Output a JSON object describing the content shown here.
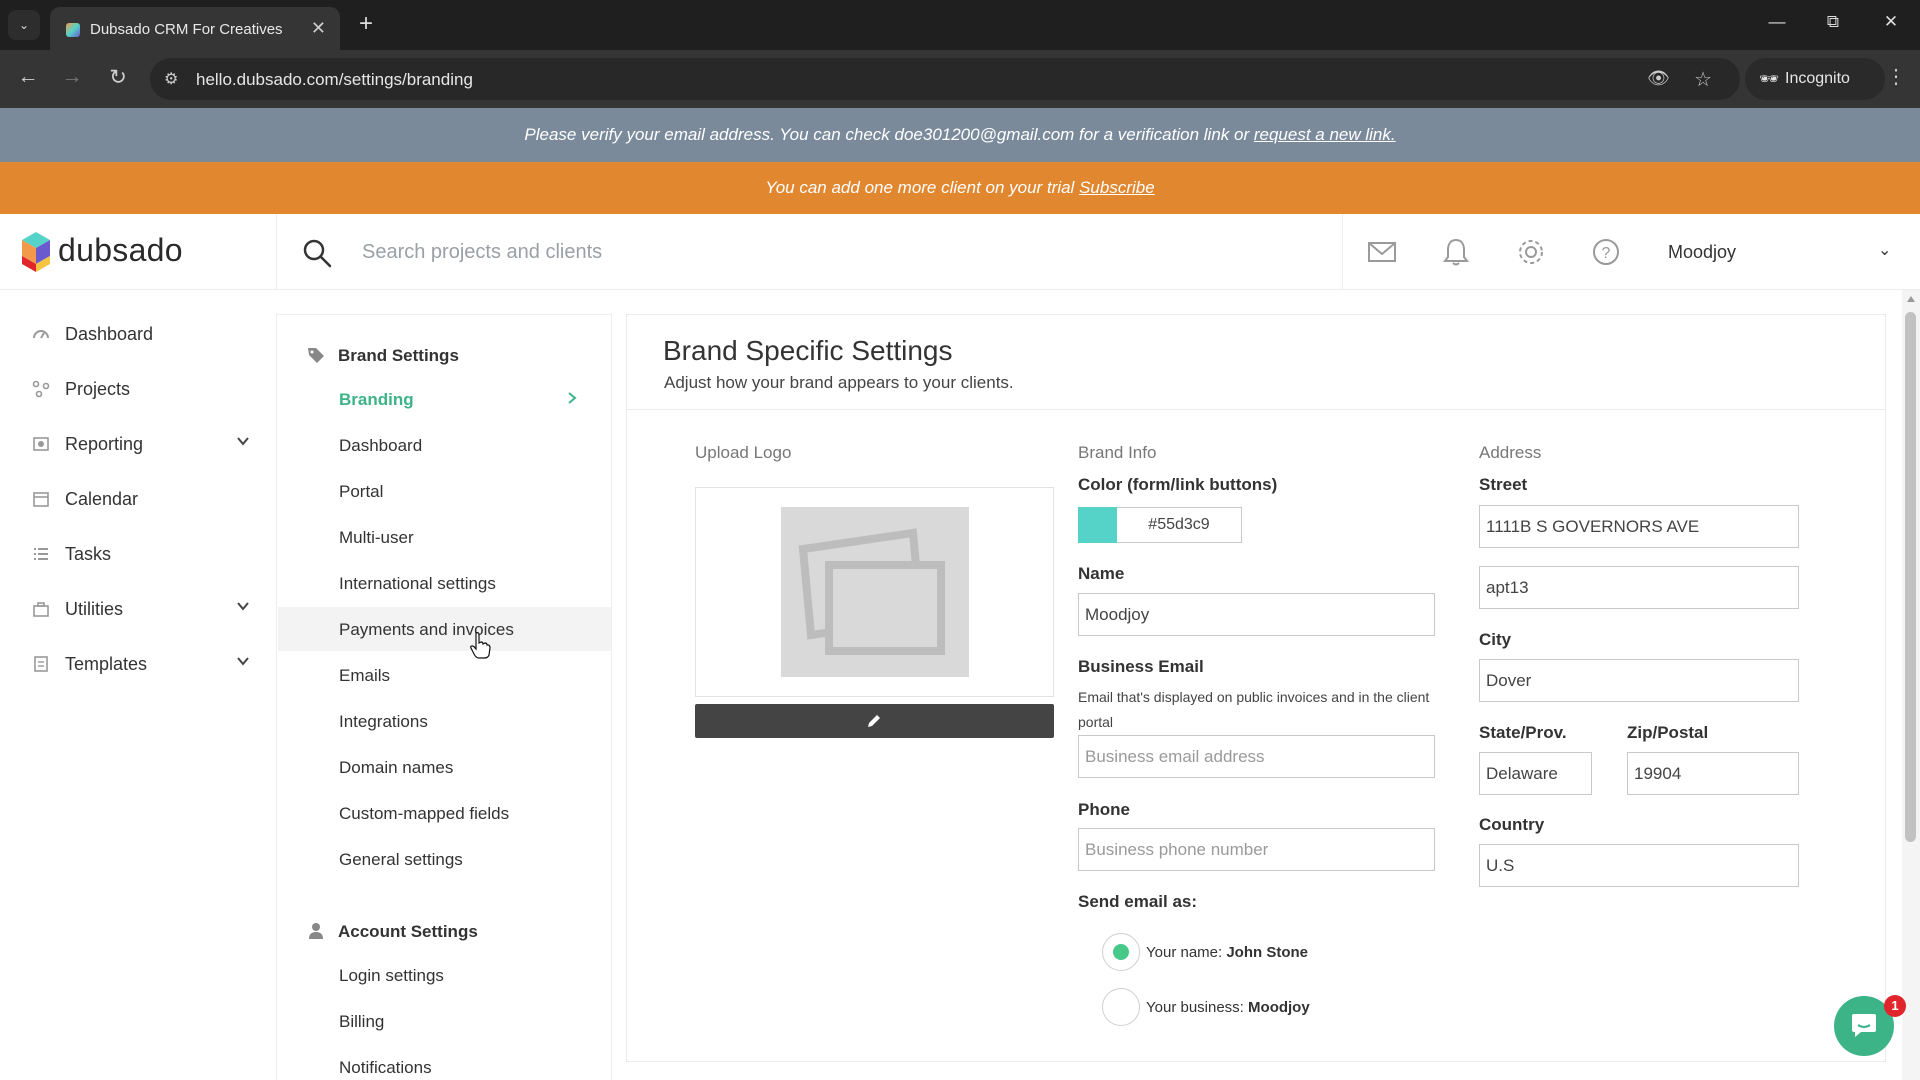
{
  "browser": {
    "tab_title": "Dubsado CRM For Creatives",
    "url": "hello.dubsado.com/settings/branding",
    "incognito_label": "Incognito"
  },
  "banners": {
    "verify_text": "Please verify your email address. You can check doe301200@gmail.com for a verification link or",
    "verify_link": "request a new link.",
    "trial_text": "You can add one more client on your trial",
    "trial_link": "Subscribe"
  },
  "header": {
    "logo_text": "dubsado",
    "search_placeholder": "Search projects and clients",
    "user_name": "Moodjoy",
    "icons": [
      "mail-icon",
      "bell-icon",
      "gear-icon",
      "help-icon"
    ]
  },
  "left_nav": {
    "items": [
      {
        "label": "Dashboard",
        "icon": "dashboard-icon",
        "expandable": false
      },
      {
        "label": "Projects",
        "icon": "projects-icon",
        "expandable": false
      },
      {
        "label": "Reporting",
        "icon": "reporting-icon",
        "expandable": true
      },
      {
        "label": "Calendar",
        "icon": "calendar-icon",
        "expandable": false
      },
      {
        "label": "Tasks",
        "icon": "tasks-icon",
        "expandable": false
      },
      {
        "label": "Utilities",
        "icon": "utilities-icon",
        "expandable": true
      },
      {
        "label": "Templates",
        "icon": "templates-icon",
        "expandable": true
      }
    ]
  },
  "settings_menu": {
    "brand_heading": "Brand Settings",
    "brand_items": [
      {
        "label": "Branding",
        "active": true
      },
      {
        "label": "Dashboard"
      },
      {
        "label": "Portal"
      },
      {
        "label": "Multi-user"
      },
      {
        "label": "International settings"
      },
      {
        "label": "Payments and invoices",
        "hover": true
      },
      {
        "label": "Emails"
      },
      {
        "label": "Integrations"
      },
      {
        "label": "Domain names"
      },
      {
        "label": "Custom-mapped fields"
      },
      {
        "label": "General settings"
      }
    ],
    "account_heading": "Account Settings",
    "account_items": [
      {
        "label": "Login settings"
      },
      {
        "label": "Billing"
      },
      {
        "label": "Notifications"
      }
    ]
  },
  "main": {
    "title": "Brand Specific Settings",
    "subtitle": "Adjust how your brand appears to your clients.",
    "upload_logo_label": "Upload Logo",
    "brand_info_label": "Brand Info",
    "color_label": "Color (form/link buttons)",
    "color_hex": "#55d3c9",
    "name_label": "Name",
    "name_value": "Moodjoy",
    "business_email_label": "Business Email",
    "business_email_help": "Email that's displayed on public invoices and in the client portal",
    "business_email_placeholder": "Business email address",
    "phone_label": "Phone",
    "phone_placeholder": "Business phone number",
    "send_as_label": "Send email as:",
    "send_as_options": [
      {
        "prefix": "Your name:",
        "value": "John Stone",
        "selected": true
      },
      {
        "prefix": "Your business:",
        "value": "Moodjoy",
        "selected": false
      }
    ],
    "address_label": "Address",
    "street_label": "Street",
    "street_value": "1111B S GOVERNORS AVE",
    "street2_value": "apt13",
    "city_label": "City",
    "city_value": "Dover",
    "state_label": "State/Prov.",
    "state_value": "Delaware",
    "zip_label": "Zip/Postal",
    "zip_value": "19904",
    "country_label": "Country",
    "country_value": "U.S"
  },
  "chat": {
    "badge_count": "1"
  },
  "colors": {
    "accent_green": "#3cb488",
    "brand_color": "#55d3c9",
    "trial_banner": "#e1872f",
    "verify_banner": "#7a8a9b"
  }
}
